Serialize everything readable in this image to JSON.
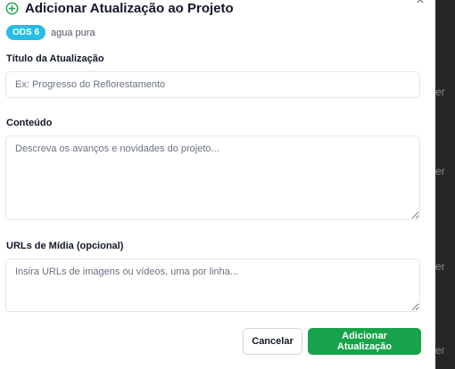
{
  "modal": {
    "title": "Adicionar Atualização ao Projeto",
    "sdg_badge": "ODS 6",
    "project_name": "agua pura",
    "close_symbol": "×"
  },
  "fields": {
    "title_label": "Título da Atualização",
    "title_placeholder": "Ex: Progresso do Reflorestamento",
    "title_value": "",
    "content_label": "Conteúdo",
    "content_placeholder": "Descreva os avanços e novidades do projeto...",
    "content_value": "",
    "media_label": "URLs de Mídia (opcional)",
    "media_placeholder": "Insira URLs de imagens ou vídeos, uma por linha...",
    "media_value": ""
  },
  "buttons": {
    "cancel_label": "Cancelar",
    "submit_label": "Adicionar Atualização"
  },
  "background": {
    "partial_texts": [
      "er",
      "er",
      "er",
      "er"
    ]
  },
  "colors": {
    "accent_green": "#16a34a",
    "sdg6_blue": "#26bde2"
  },
  "icons": {
    "title_icon": "plus-circle-icon",
    "close_icon": "close-icon"
  }
}
